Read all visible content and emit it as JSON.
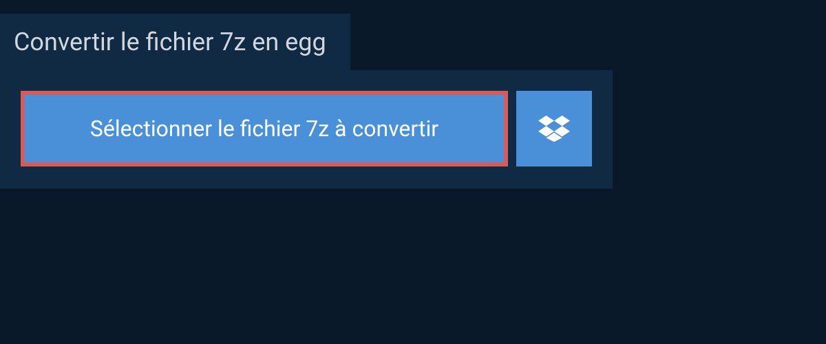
{
  "header": {
    "title": "Convertir le fichier 7z en egg"
  },
  "actions": {
    "select_file_label": "Sélectionner le fichier 7z à convertir",
    "dropbox_icon": "dropbox"
  },
  "colors": {
    "background": "#0a1929",
    "panel": "#0f2a42",
    "button_primary": "#4a90d9",
    "highlight_border": "#d65c5c",
    "text_light": "#d0d7de",
    "text_white": "#ffffff"
  }
}
